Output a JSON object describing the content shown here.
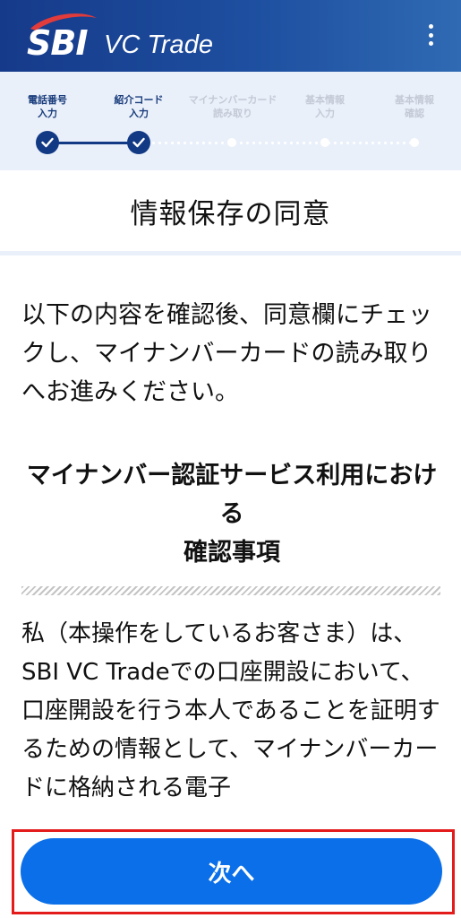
{
  "header": {
    "logo_sbi": "SBI",
    "logo_vc": "VC Trade",
    "menu_icon": "kebab-menu-icon"
  },
  "stepper": {
    "steps": [
      {
        "label": "電話番号\n入力",
        "status": "done"
      },
      {
        "label": "紹介コード\n入力",
        "status": "done"
      },
      {
        "label": "マイナンバーカード\n読み取り",
        "status": "todo"
      },
      {
        "label": "基本情報\n入力",
        "status": "todo"
      },
      {
        "label": "基本情報\n確認",
        "status": "todo"
      }
    ]
  },
  "page": {
    "title": "情報保存の同意",
    "intro": "以下の内容を確認後、同意欄にチェックし、マイナンバーカードの読み取りへお進みください。",
    "section_heading": "マイナンバー認証サービス利用における\n確認事項",
    "body": "私（本操作をしているお客さま）は、SBI VC Tradeでの口座開設において、口座開設を行う本人であることを証明するための情報として、マイナンバーカードに格納される電子"
  },
  "footer": {
    "next_label": "次へ"
  },
  "colors": {
    "header_start": "#163a8a",
    "header_end": "#2f6ab3",
    "stepper_bg": "#eaf0fa",
    "step_done": "#123a84",
    "primary_button": "#0a6fe8",
    "highlight_outline": "#e41b1b"
  }
}
